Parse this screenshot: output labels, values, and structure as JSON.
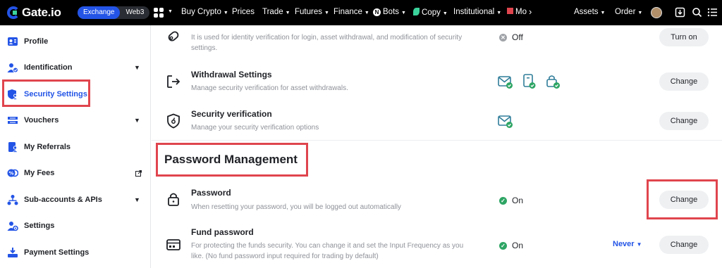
{
  "topbar": {
    "logo_text": "Gate.io",
    "segment": {
      "exchange": "Exchange",
      "web3": "Web3"
    },
    "nav": [
      {
        "label": "Buy Crypto",
        "caret": true
      },
      {
        "label": "Prices",
        "caret": false
      },
      {
        "label": "Trade",
        "caret": true
      },
      {
        "label": "Futures",
        "caret": true
      },
      {
        "label": "Finance",
        "caret": true
      },
      {
        "label": "Bots",
        "caret": true
      },
      {
        "label": "Copy",
        "caret": true
      },
      {
        "label": "Institutional",
        "caret": true
      },
      {
        "label": "Mo",
        "caret": false
      }
    ],
    "assets": "Assets",
    "order": "Order",
    "brand_color": "#2354e6"
  },
  "sidebar": {
    "items": [
      {
        "label": "Profile",
        "icon": "profile-card-icon",
        "chevron": false,
        "active": false,
        "external": false
      },
      {
        "label": "Identification",
        "icon": "user-check-icon",
        "chevron": true,
        "active": false,
        "external": false
      },
      {
        "label": "Security Settings",
        "icon": "shield-user-icon",
        "chevron": false,
        "active": true,
        "external": false
      },
      {
        "label": "Vouchers",
        "icon": "ticket-icon",
        "chevron": true,
        "active": false,
        "external": false
      },
      {
        "label": "My Referrals",
        "icon": "referral-icon",
        "chevron": false,
        "active": false,
        "external": false
      },
      {
        "label": "My Fees",
        "icon": "fees-icon",
        "chevron": false,
        "active": false,
        "external": true
      },
      {
        "label": "Sub-accounts & APIs",
        "icon": "sub-accounts-icon",
        "chevron": true,
        "active": false,
        "external": false
      },
      {
        "label": "Settings",
        "icon": "settings-user-icon",
        "chevron": false,
        "active": false,
        "external": false
      },
      {
        "label": "Payment Settings",
        "icon": "payment-icon",
        "chevron": false,
        "active": false,
        "external": false
      }
    ]
  },
  "main": {
    "top_partial": {
      "desc": "It is used for identity verification for login, asset withdrawal, and modification of security settings.",
      "status": "Off",
      "button": "Turn on"
    },
    "withdrawal": {
      "title": "Withdrawal Settings",
      "desc": "Manage security verification for asset withdrawals.",
      "button": "Change"
    },
    "security_verification": {
      "title": "Security verification",
      "desc": "Manage your security verification options",
      "button": "Change"
    },
    "password_section": {
      "heading": "Password Management"
    },
    "password": {
      "title": "Password",
      "desc": "When resetting your password, you will be logged out automatically",
      "status": "On",
      "button": "Change"
    },
    "fund_password": {
      "title": "Fund password",
      "desc": "For protecting the funds security. You can change it and set the Input Frequency as you like. (No fund password input required for trading by default)",
      "status": "On",
      "frequency": "Never",
      "button": "Change"
    },
    "colors": {
      "on": "#2ea564",
      "off": "#a0a3a8",
      "accent": "#2354e6",
      "highlight": "#e0454e"
    }
  }
}
